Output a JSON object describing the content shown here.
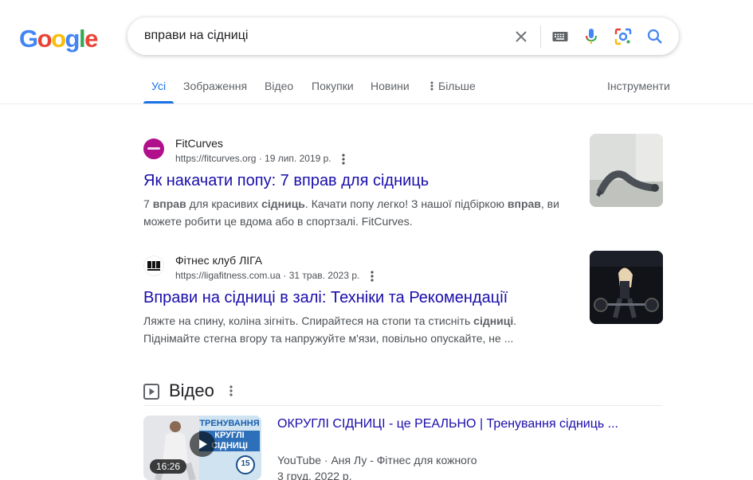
{
  "logo": {
    "letters": [
      "G",
      "o",
      "o",
      "g",
      "l",
      "e"
    ],
    "colors": [
      "#4285F4",
      "#EA4335",
      "#FBBC05",
      "#4285F4",
      "#34A853",
      "#EA4335"
    ]
  },
  "search": {
    "query": "вправи на сідниці",
    "icons": [
      "close-icon",
      "keyboard-icon",
      "mic-icon",
      "lens-icon",
      "search-icon"
    ]
  },
  "tabs": {
    "all": "Усі",
    "images": "Зображення",
    "video": "Відео",
    "shopping": "Покупки",
    "news": "Новини",
    "more": "Більше",
    "tools": "Інструменти"
  },
  "results": [
    {
      "site_name": "FitCurves",
      "url": "https://fitcurves.org",
      "date": " · 19 лип. 2019 р.",
      "title": "Як накачати попу: 7 вправ для сідниць",
      "snippet_html": "7 <b>вправ</b> для красивих <b>сідниць</b>. Качати попу легко! З нашої підбіркою <b>вправ</b>, ви можете робити це вдома або в спортзалі. FitCurves."
    },
    {
      "site_name": "Фітнес клуб ЛІГА",
      "url": "https://ligafitness.com.ua",
      "date": " · 31 трав. 2023 р.",
      "title": "Вправи на сідниці в залі: Техніки та Рекомендації",
      "snippet_html": "Ляжте на спину, коліна зігніть. Спирайтеся на стопи та стисніть <b>сідниці</b>. Піднімайте стегна вгору та напружуйте м'язи, повільно опускайте, не ..."
    }
  ],
  "video_section": {
    "heading": "Відео",
    "item": {
      "title": "ОКРУГЛІ СІДНИЦІ - це РЕАЛЬНО | Тренування сідниць ...",
      "source": "YouTube",
      "channel": " · Аня Лу - Фітнес для кожного",
      "date": "3 груд. 2022 р.",
      "duration": "16:26",
      "thumb_text_1": "ТРЕНУВАННЯ",
      "thumb_text_2": "КРУГЛІ СІДНИЦІ",
      "badge": "15"
    }
  },
  "colors": {
    "link": "#1a0dab",
    "accent": "#1a73e8",
    "muted": "#4d5156"
  }
}
